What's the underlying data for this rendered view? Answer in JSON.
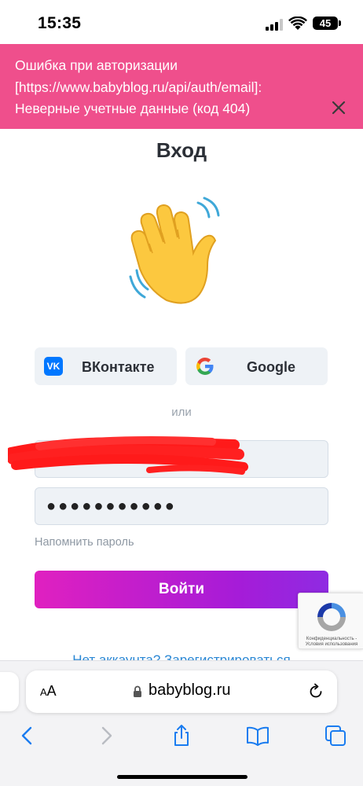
{
  "status_bar": {
    "time": "15:35",
    "battery": "45"
  },
  "toast": {
    "message": "Ошибка при авторизации [https://www.babyblog.ru/api/auth/email]: Неверные учетные данные (код 404)",
    "icon": "close-icon"
  },
  "login": {
    "title": "Вход",
    "illustration": "waving-hand-emoji",
    "social": {
      "vk_label": "ВКонтакте",
      "vk_icon_text": "VK",
      "google_label": "Google"
    },
    "or_label": "или",
    "email_value": "",
    "password_value": "●●●●●●●●●●●",
    "remind_password": "Напомнить пароль",
    "submit_label": "Войти",
    "register_link": "Нет аккаунта? Зарегистрироваться",
    "recaptcha_text": "Конфиденциальность - Условия использования"
  },
  "browser": {
    "text_size_label_small": "A",
    "text_size_label_large": "A",
    "url": "babyblog.ru",
    "icons": [
      "back-icon",
      "forward-icon",
      "share-icon",
      "bookmarks-icon",
      "tabs-icon",
      "reload-icon",
      "lock-icon"
    ]
  },
  "colors": {
    "toast_bg": "#ef4f8c",
    "button_gradient_start": "#e020c0",
    "button_gradient_end": "#8f2be2",
    "link": "#2a87d4",
    "field_bg": "#eef2f6",
    "vk_blue": "#0077ff"
  }
}
